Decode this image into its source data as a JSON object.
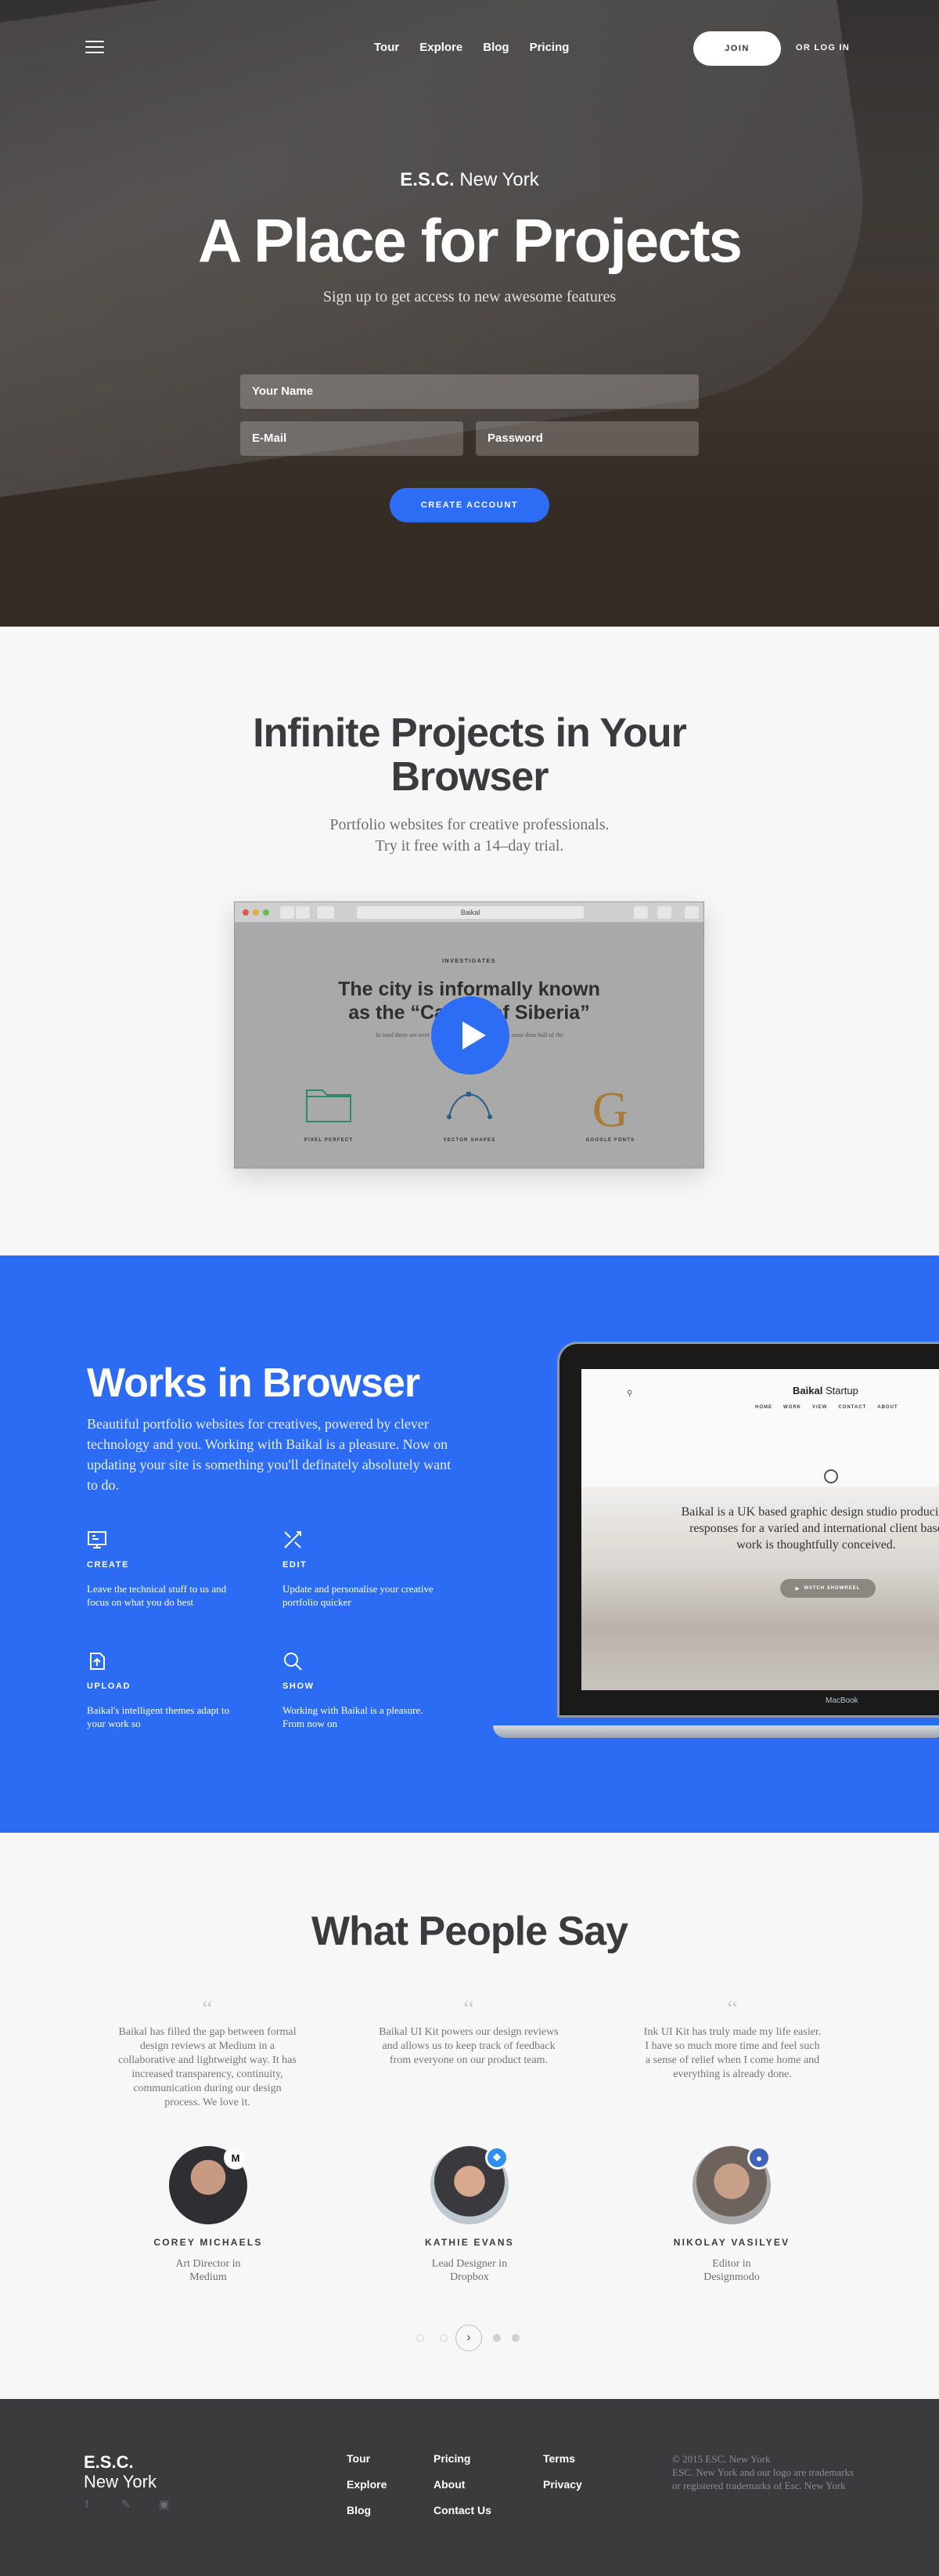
{
  "nav": {
    "menu_icon": "hamburger-icon",
    "links": [
      "Tour",
      "Explore",
      "Blog",
      "Pricing"
    ],
    "join_label": "JOIN",
    "login_label": "OR LOG IN"
  },
  "hero": {
    "brand_bold": "E.S.C.",
    "brand_light": "New York",
    "title": "A Place for Projects",
    "subtitle": "Sign up to get access to new awesome features",
    "name_placeholder": "Your Name",
    "email_placeholder": "E-Mail",
    "password_placeholder": "Password",
    "cta_label": "CREATE ACCOUNT"
  },
  "intro": {
    "title": "Infinite Projects in Your Browser",
    "subtitle_line1": "Portfolio websites for creative professionals.",
    "subtitle_line2": "Try it free with a 14–day trial.",
    "browser": {
      "url": "Baikal",
      "kicker": "INVESTIGATES",
      "headline_line1": "The city is informally known",
      "headline_line2": "as the “Capital of Siberia”",
      "small_text": "In total there are over 100 monuments in the lake, but none than half of the Baikal is a part of the Altai...",
      "features": [
        "PIXEL PERFECT",
        "VECTOR SHAPES",
        "GOOGLE FONTS"
      ],
      "play_icon": "play-icon"
    }
  },
  "works": {
    "title": "Works in Browser",
    "text": "Beautiful portfolio websites for creatives, powered by clever technology and you. Working with Baikal is a pleasure. Now on updating your site is something you'll definately absolutely want to do.",
    "features": [
      {
        "icon": "create-icon",
        "title": "CREATE",
        "desc": "Leave the technical stuff to us and focus on what you do best"
      },
      {
        "icon": "edit-icon",
        "title": "EDIT",
        "desc": "Update and personalise your creative portfolio quicker"
      },
      {
        "icon": "upload-icon",
        "title": "UPLOAD",
        "desc": "Baikal's intelligent themes adapt to your work so"
      },
      {
        "icon": "show-icon",
        "title": "SHOW",
        "desc": "Working with Baikal is a pleasure. From now on"
      }
    ],
    "laptop": {
      "brand_bold": "Baikal",
      "brand_light": "Startup",
      "menu": [
        "HOME",
        "WORK",
        "VIEW",
        "CONTACT",
        "ABOUT"
      ],
      "text_line1": "Baikal is a UK based graphic design studio producing",
      "text_line2": "responses for a varied and international client base",
      "text_line3": "work is thoughtfully conceived.",
      "button": "WATCH SHOWREEL",
      "model": "MacBook"
    }
  },
  "testimonials": {
    "title": "What People Say",
    "items": [
      {
        "quote": "Baikal has filled the gap between formal design reviews at Medium in a collaborative and lightweight way. It has increased transparency, continuity, communication during our design process. We love it.",
        "name": "COREY MICHAELS",
        "role_line1": "Art Director in",
        "role_line2": "Medium",
        "badge": "M"
      },
      {
        "quote": "Baikal UI Kit powers our design reviews and allows us to keep track of feedback from everyone on our product team.",
        "name": "KATHIE EVANS",
        "role_line1": "Lead Designer in",
        "role_line2": "Dropbox",
        "badge": "dropbox-icon"
      },
      {
        "quote": "Ink UI Kit has truly made my life easier. I have so much more time and feel such a sense of relief when I come home and everything is already done.",
        "name": "NIKOLAY VASILYEV",
        "role_line1": "Editor in",
        "role_line2": "Designmodo",
        "badge": "designmodo-icon"
      }
    ],
    "pager_next": "›"
  },
  "footer": {
    "brand_bold": "E.S.C.",
    "brand_light": "New York",
    "col1": [
      "Tour",
      "Explore",
      "Blog"
    ],
    "col2": [
      "Pricing",
      "About",
      "Contact Us"
    ],
    "col3": [
      "Terms",
      "Privacy"
    ],
    "social": [
      "facebook-icon",
      "twitter-icon",
      "instagram-icon"
    ],
    "legal_line1": "© 2015 ESC. New York",
    "legal_line2": "ESC. New York and our logo are trademarks or registered trademarks of Esc. New York"
  },
  "colors": {
    "accent": "#2d6df6",
    "dark": "#3b3b3d",
    "footer": "#3b3b3e"
  }
}
